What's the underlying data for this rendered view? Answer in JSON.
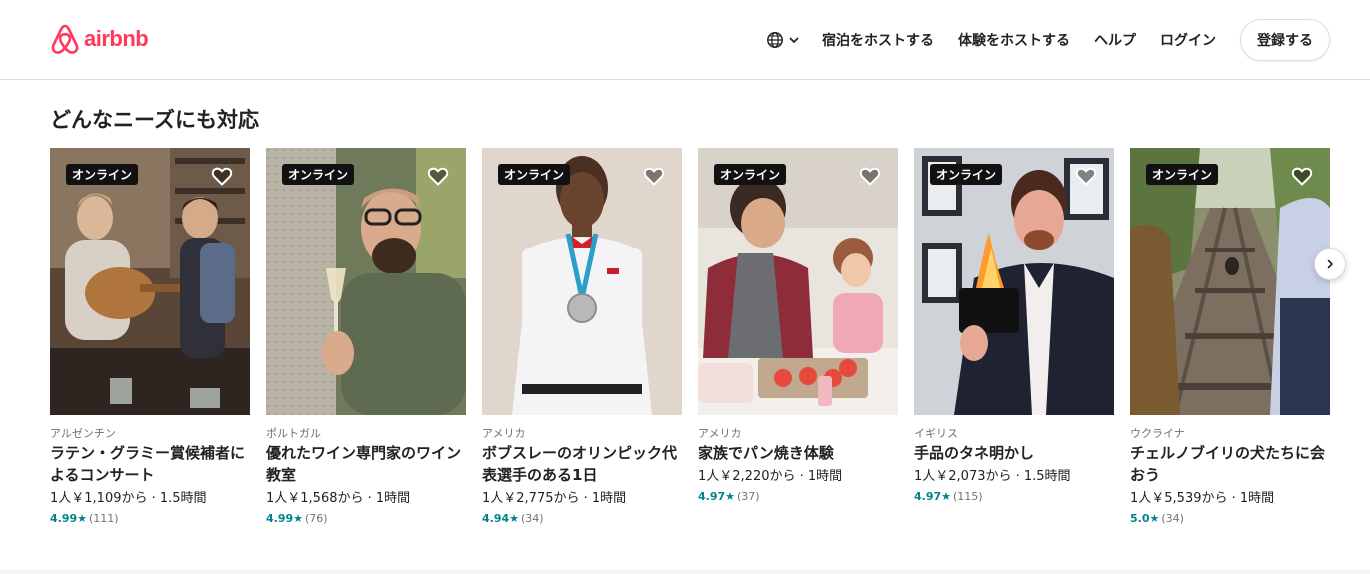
{
  "brand": {
    "name": "airbnb",
    "color": "#FF385C"
  },
  "nav": {
    "language_icon": "globe-icon",
    "links": [
      "宿泊をホストする",
      "体験をホストする",
      "ヘルプ",
      "ログイン"
    ],
    "signup": "登録する"
  },
  "section": {
    "title": "どんなニーズにも対応"
  },
  "cards": [
    {
      "badge": "オンライン",
      "country": "アルゼンチン",
      "title": "ラテン・グラミー賞候補者によるコンサート",
      "price": "1人￥1,109から · 1.5時間",
      "rating": "4.99★",
      "reviews": "(111)"
    },
    {
      "badge": "オンライン",
      "country": "ポルトガル",
      "title": "優れたワイン専門家のワイン教室",
      "price": "1人￥1,568から · 1時間",
      "rating": "4.99★",
      "reviews": "(76)"
    },
    {
      "badge": "オンライン",
      "country": "アメリカ",
      "title": "ボブスレーのオリンピック代表選手のある1日",
      "price": "1人￥2,775から · 1時間",
      "rating": "4.94★",
      "reviews": "(34)"
    },
    {
      "badge": "オンライン",
      "country": "アメリカ",
      "title": "家族でパン焼き体験",
      "price": "1人￥2,220から · 1時間",
      "rating": "4.97★",
      "reviews": "(37)"
    },
    {
      "badge": "オンライン",
      "country": "イギリス",
      "title": "手品のタネ明かし",
      "price": "1人￥2,073から · 1.5時間",
      "rating": "4.97★",
      "reviews": "(115)"
    },
    {
      "badge": "オンライン",
      "country": "ウクライナ",
      "title": "チェルノブイリの犬たちに会おう",
      "price": "1人￥5,539から · 1時間",
      "rating": "5.0★",
      "reviews": "(34)"
    }
  ],
  "icons": {
    "heart": "heart-icon",
    "next": "chevron-right-icon",
    "rating_color": "#008489"
  }
}
